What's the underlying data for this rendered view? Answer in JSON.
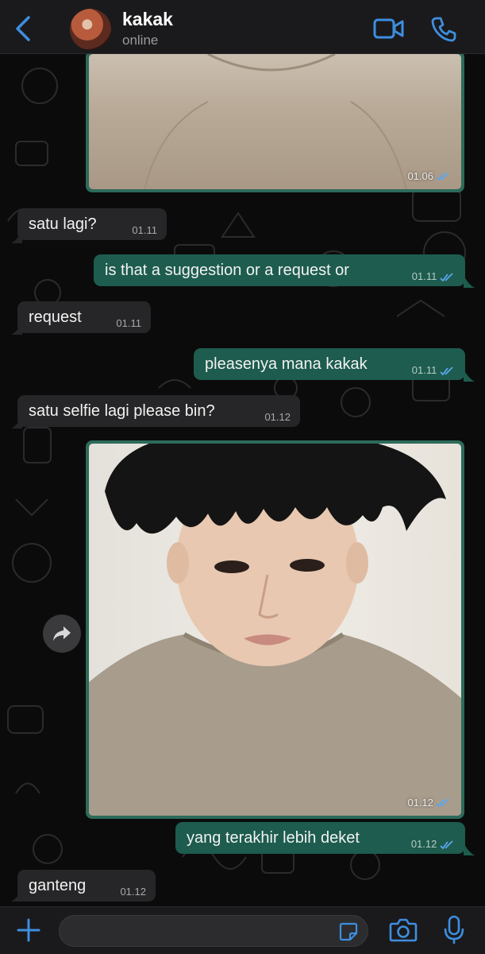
{
  "header": {
    "contact_name": "kakak",
    "status": "online",
    "icons": [
      "back-chevron-icon",
      "video-call-icon",
      "phone-call-icon"
    ]
  },
  "messages": [
    {
      "type": "photo",
      "direction": "out",
      "time": "01.06",
      "read": true
    },
    {
      "type": "text",
      "direction": "in",
      "text": "satu lagi?",
      "time": "01.11"
    },
    {
      "type": "text",
      "direction": "out",
      "text": "is that a suggestion or a request or",
      "time": "01.11",
      "read": true
    },
    {
      "type": "text",
      "direction": "in",
      "text": "request",
      "time": "01.11"
    },
    {
      "type": "text",
      "direction": "out",
      "text": "pleasenya mana kakak",
      "time": "01.11",
      "read": true
    },
    {
      "type": "text",
      "direction": "in",
      "text": "satu selfie lagi please bin?",
      "time": "01.12"
    },
    {
      "type": "photo",
      "direction": "out",
      "time": "01.12",
      "read": true
    },
    {
      "type": "text",
      "direction": "out",
      "text": "yang terakhir lebih deket",
      "time": "01.12",
      "read": true
    },
    {
      "type": "text",
      "direction": "in",
      "text": "ganteng",
      "time": "01.12"
    }
  ],
  "composer": {
    "placeholder": "",
    "icons": [
      "plus-icon",
      "sticker-icon",
      "camera-icon",
      "microphone-icon"
    ]
  },
  "colors": {
    "accent": "#3e8ee0",
    "outgoing_bubble": "#1d5c4e",
    "incoming_bubble": "#262628",
    "read_ticks": "#5aa7f0"
  }
}
